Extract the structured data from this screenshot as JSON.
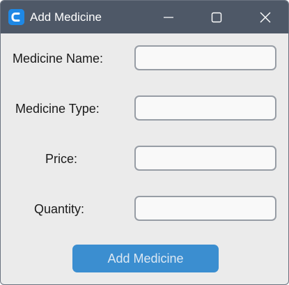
{
  "window": {
    "title": "Add Medicine",
    "accent_color": "#3b8ed0",
    "titlebar_color": "#4e5867"
  },
  "titlebar_controls": {
    "minimize_icon": "minimize-icon",
    "maximize_icon": "maximize-icon",
    "close_icon": "close-icon"
  },
  "form": {
    "fields": [
      {
        "key": "name",
        "label": "Medicine Name:",
        "value": "",
        "placeholder": ""
      },
      {
        "key": "type",
        "label": "Medicine Type:",
        "value": "",
        "placeholder": ""
      },
      {
        "key": "price",
        "label": "Price:",
        "value": "",
        "placeholder": ""
      },
      {
        "key": "quantity",
        "label": "Quantity:",
        "value": "",
        "placeholder": ""
      }
    ],
    "submit_label": "Add Medicine"
  }
}
